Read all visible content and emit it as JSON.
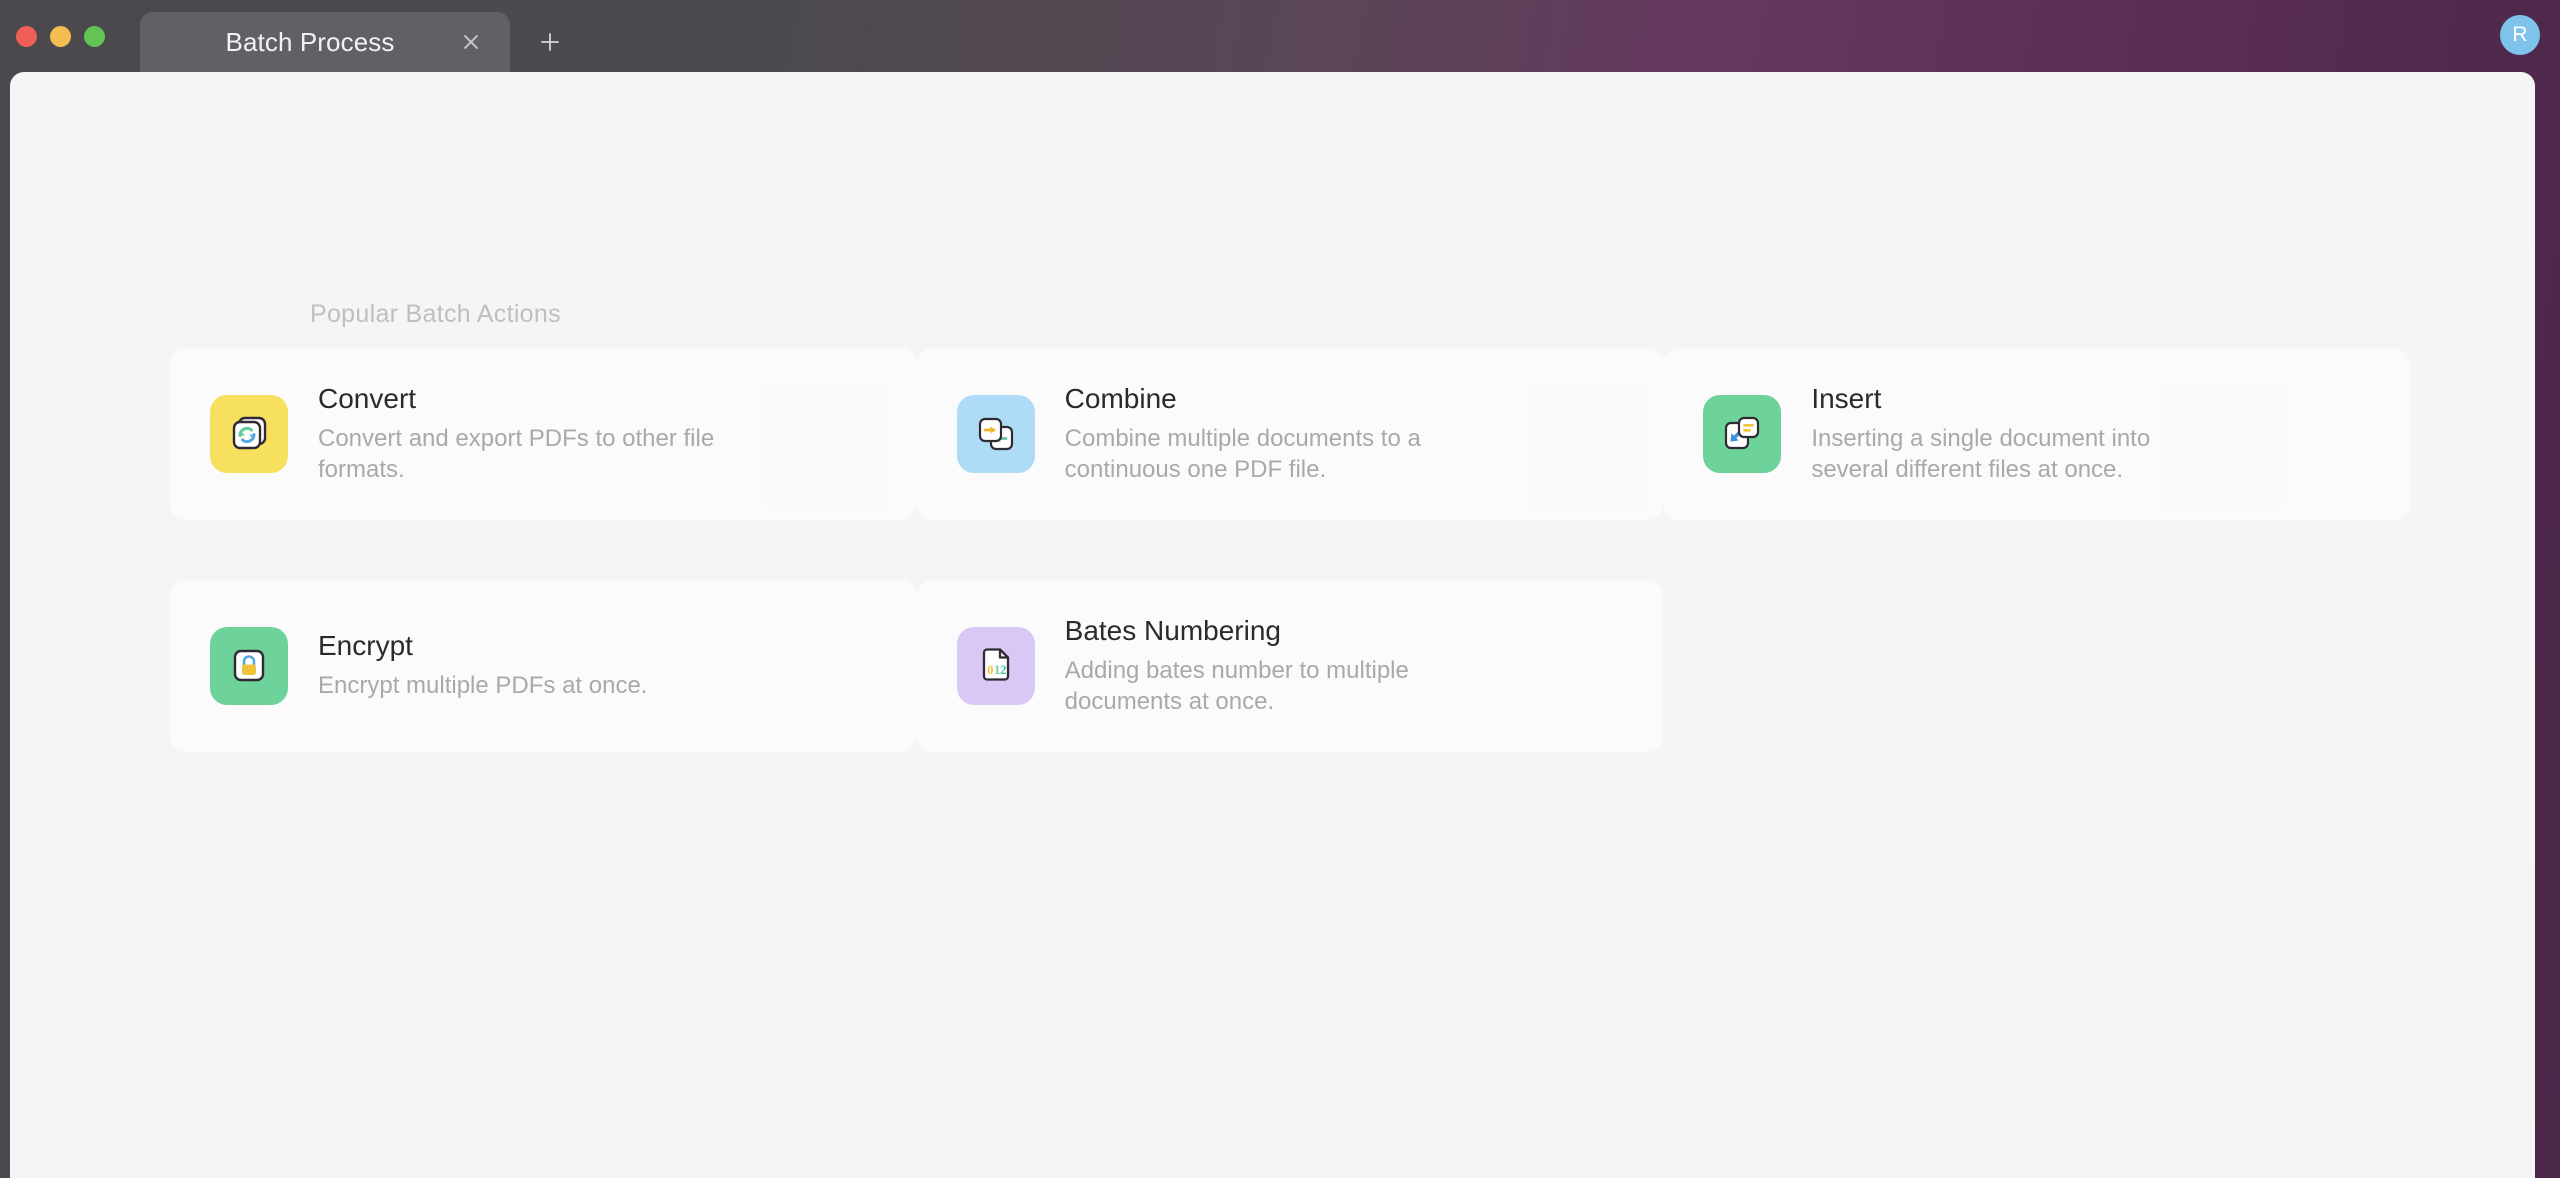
{
  "window": {
    "traffic_lights": [
      "close",
      "minimize",
      "maximize"
    ],
    "tab": {
      "title": "Batch Process",
      "close_icon": "close-icon"
    },
    "new_tab_icon": "plus-icon",
    "avatar_initial": "R",
    "avatar_color": "#7fc2ec"
  },
  "main": {
    "section_label": "Popular Batch Actions",
    "cards": [
      {
        "title": "Convert",
        "desc": "Convert and export PDFs to other file formats.",
        "icon": "convert-icon",
        "icon_bg": "#f7e05e"
      },
      {
        "title": "Combine",
        "desc": "Combine multiple documents to a continuous one PDF file.",
        "icon": "combine-icon",
        "icon_bg": "#aedbf5"
      },
      {
        "title": "Insert",
        "desc": "Inserting a single document into several different files at once.",
        "icon": "insert-icon",
        "icon_bg": "#6ed39a"
      },
      {
        "title": "Encrypt",
        "desc": "Encrypt multiple PDFs at once.",
        "icon": "encrypt-icon",
        "icon_bg": "#6ed39a"
      },
      {
        "title": "Bates Numbering",
        "desc": "Adding bates number to multiple documents at once.",
        "icon": "bates-numbering-icon",
        "icon_bg": "#d9c8f5"
      }
    ]
  }
}
